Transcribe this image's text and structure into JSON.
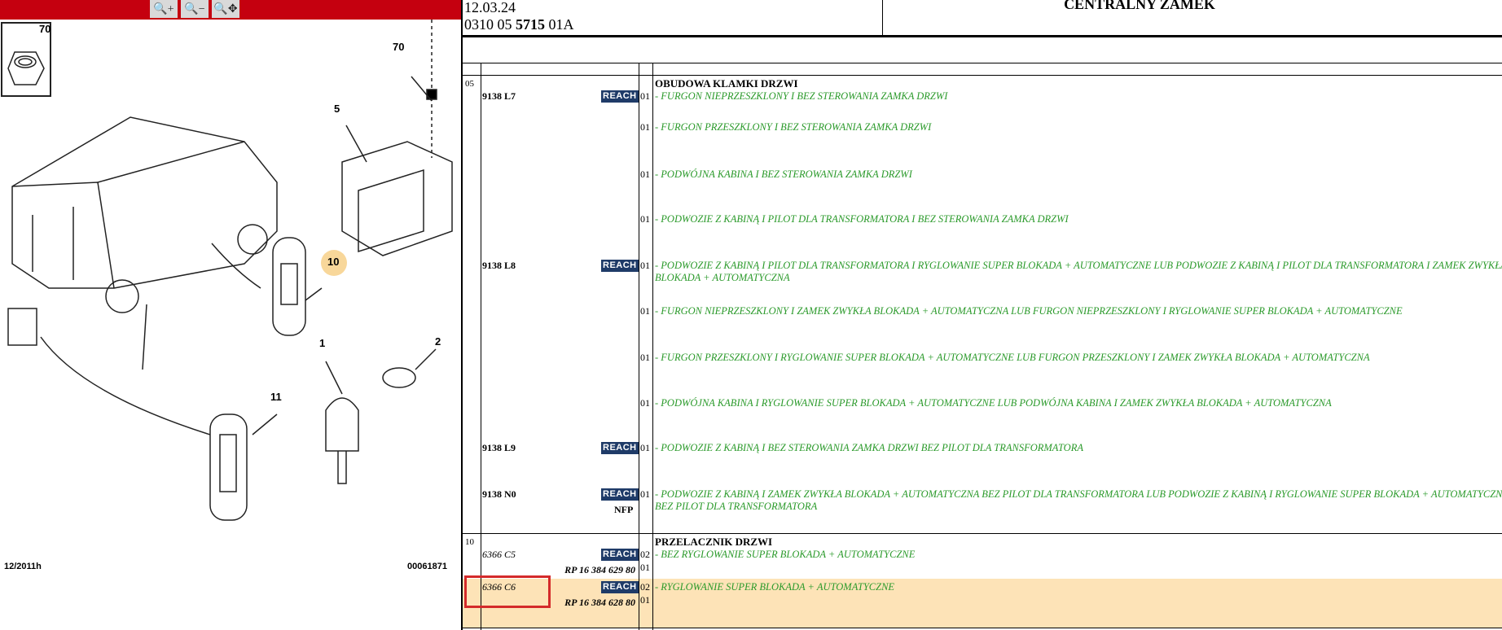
{
  "toolbar": {
    "buttons": [
      {
        "name": "zoom-in",
        "glyph": "🔍+"
      },
      {
        "name": "zoom-out",
        "glyph": "🔍−"
      },
      {
        "name": "zoom-pan",
        "glyph": "🔍✥"
      }
    ]
  },
  "diagram": {
    "callouts": [
      "70",
      "70",
      "5",
      "10",
      "1",
      "2",
      "11"
    ],
    "date_code": "12/2011h",
    "image_ref": "00061871"
  },
  "header": {
    "date": "12.03.24",
    "ref_prefix": "0310 05 ",
    "ref_bold": "5715",
    "ref_suffix": " 01A",
    "title": "CENTRALNY ZAMEK"
  },
  "badge": "REACH",
  "groups": [
    {
      "num": "05",
      "title": "OBUDOWA KLAMKI DRZWI"
    },
    {
      "num": "10",
      "title": "PRZELACZNIK DRZWI"
    }
  ],
  "rows": [
    {
      "part": "9138 L7",
      "qty": "01",
      "desc": "- FURGON NIEPRZESZKLONY I BEZ STEROWANIA ZAMKA DRZWI"
    },
    {
      "part": "",
      "qty": "01",
      "desc": "- FURGON PRZESZKLONY I BEZ STEROWANIA ZAMKA DRZWI"
    },
    {
      "part": "",
      "qty": "01",
      "desc": "- PODWÓJNA KABINA I BEZ STEROWANIA ZAMKA DRZWI"
    },
    {
      "part": "",
      "qty": "01",
      "desc": "- PODWOZIE Z KABINĄ I PILOT DLA TRANSFORMATORA I BEZ STEROWANIA ZAMKA DRZWI"
    },
    {
      "part": "9138 L8",
      "qty": "01",
      "desc": "- PODWOZIE Z KABINĄ I PILOT DLA TRANSFORMATORA I RYGLOWANIE SUPER BLOKADA + AUTOMATYCZNE LUB PODWOZIE Z KABINĄ I PILOT DLA TRANSFORMATORA I ZAMEK ZWYKŁA BLOKADA + AUTOMATYCZNA"
    },
    {
      "part": "",
      "qty": "01",
      "desc": "- FURGON NIEPRZESZKLONY I ZAMEK ZWYKŁA BLOKADA + AUTOMATYCZNA LUB FURGON NIEPRZESZKLONY I RYGLOWANIE SUPER BLOKADA + AUTOMATYCZNE"
    },
    {
      "part": "",
      "qty": "01",
      "desc": "- FURGON PRZESZKLONY I RYGLOWANIE SUPER BLOKADA + AUTOMATYCZNE LUB FURGON PRZESZKLONY I ZAMEK ZWYKŁA BLOKADA + AUTOMATYCZNA"
    },
    {
      "part": "",
      "qty": "01",
      "desc": "- PODWÓJNA KABINA I RYGLOWANIE SUPER BLOKADA + AUTOMATYCZNE LUB PODWÓJNA KABINA I ZAMEK ZWYKŁA BLOKADA + AUTOMATYCZNA"
    },
    {
      "part": "9138 L9",
      "qty": "01",
      "desc": "- PODWOZIE Z KABINĄ I BEZ STEROWANIA ZAMKA DRZWI BEZ PILOT DLA TRANSFORMATORA"
    },
    {
      "part": "9138 N0",
      "qty": "01",
      "desc": "- PODWOZIE Z KABINĄ I ZAMEK ZWYKŁA BLOKADA + AUTOMATYCZNA BEZ PILOT DLA TRANSFORMATORA LUB PODWOZIE Z KABINĄ I RYGLOWANIE SUPER BLOKADA + AUTOMATYCZNE BEZ PILOT DLA TRANSFORMATORA",
      "note": "NFP"
    },
    {
      "part": "6366 C5",
      "qty": "02",
      "desc": "- BEZ RYGLOWANIE SUPER BLOKADA + AUTOMATYCZNE",
      "rp": "RP 16 384 629 80",
      "rp_qty": "01"
    },
    {
      "part": "6366 C6",
      "qty": "02",
      "desc": "- RYGLOWANIE SUPER BLOKADA + AUTOMATYCZNE",
      "rp": "RP 16 384 628 80",
      "rp_qty": "01"
    }
  ]
}
